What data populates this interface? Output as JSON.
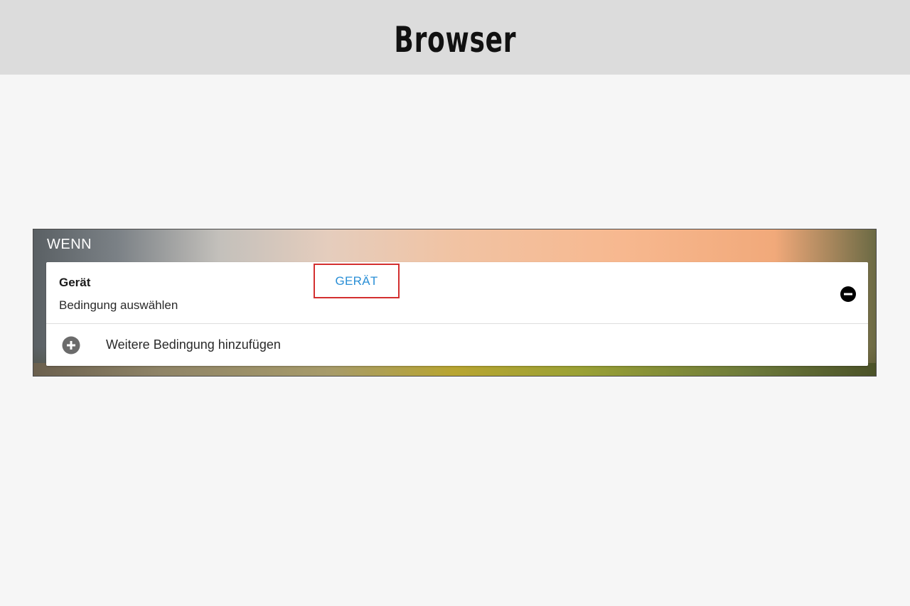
{
  "banner": {
    "title": "Browser"
  },
  "panel": {
    "header": "WENN",
    "condition": {
      "title": "Gerät",
      "subtitle": "Bedingung auswählen",
      "device_button_label": "GERÄT",
      "highlight_color": "#d32f2f",
      "link_color": "#2a8fd6"
    },
    "add_condition_label": "Weitere Bedingung hinzufügen",
    "icons": {
      "remove": "minus-circle-icon",
      "add": "plus-circle-icon"
    }
  }
}
